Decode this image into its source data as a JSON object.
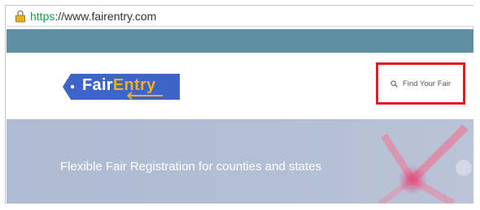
{
  "browser": {
    "url_scheme": "https",
    "url_rest": "://www.fairentry.com",
    "lock_icon": "padlock-icon",
    "secure_color": "#12a04a"
  },
  "site": {
    "logo": {
      "fair": "Fair",
      "entry": "Entry",
      "primary_color": "#3d64c8",
      "accent_color": "#f2b01e"
    },
    "find_fair": {
      "label": "Find Your Fair",
      "icon": "search-icon",
      "highlight_color": "#e01b22"
    },
    "hero": {
      "tagline": "Flexible Fair Registration for counties and states"
    },
    "nav_bar_color": "#5f8fa2"
  }
}
